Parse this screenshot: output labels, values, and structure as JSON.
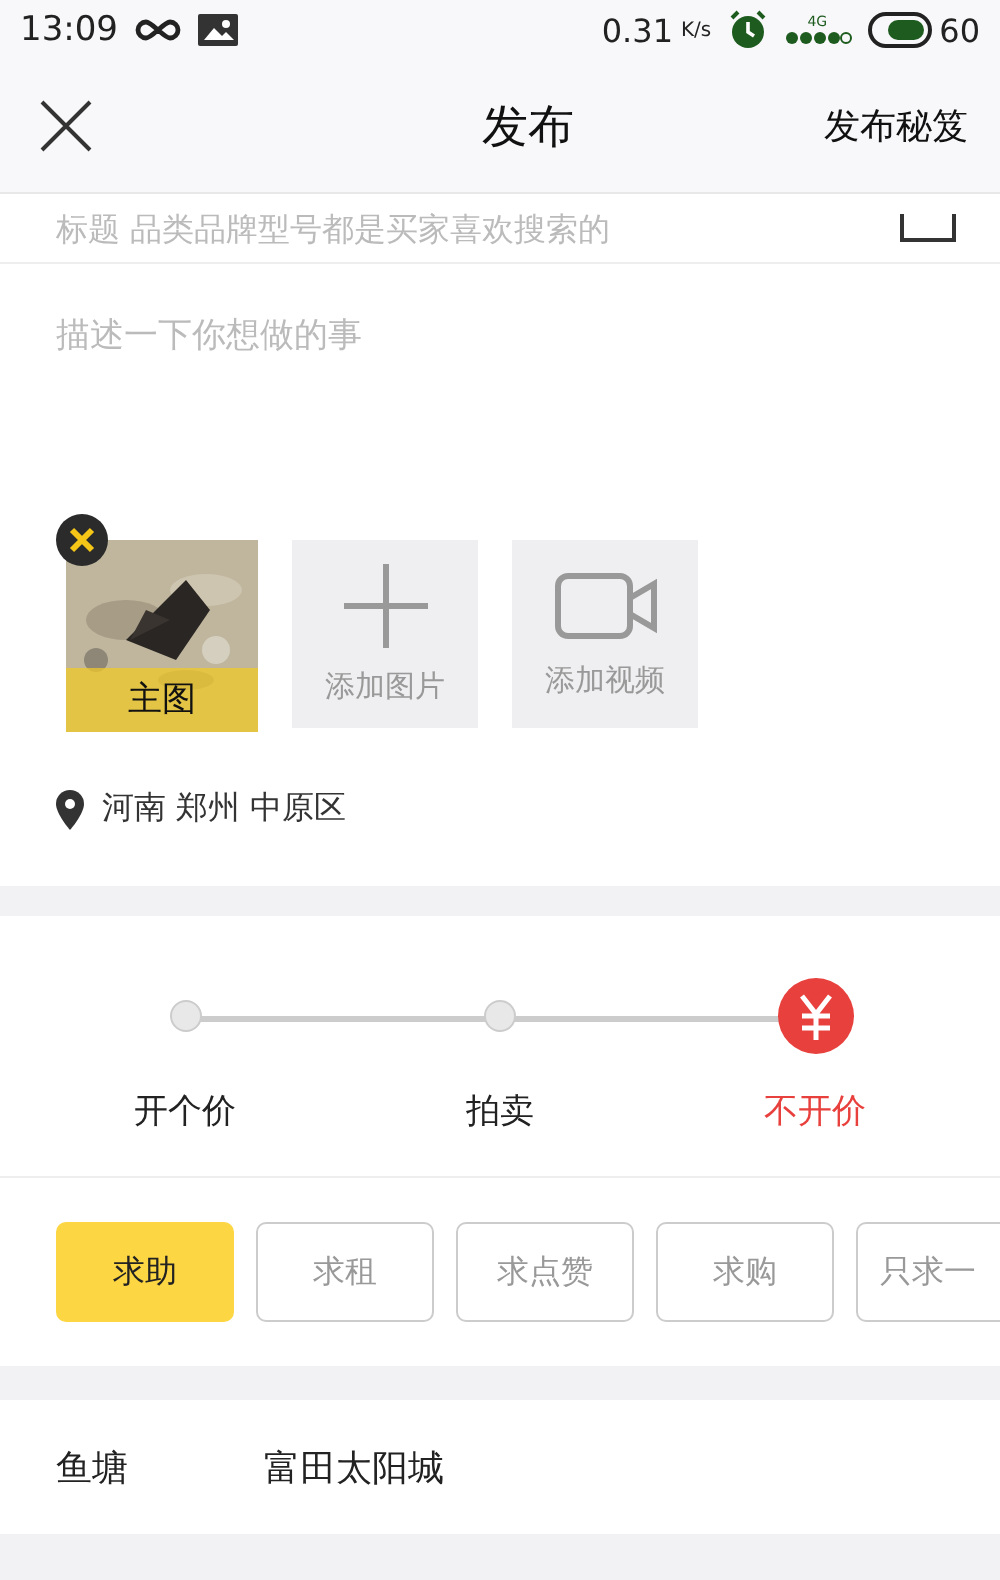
{
  "status_bar": {
    "time": "13:09",
    "speed": "0.31",
    "speed_unit": "K/s",
    "network": "4G",
    "battery": "60"
  },
  "header": {
    "title": "发布",
    "action": "发布秘笈"
  },
  "title_field": {
    "placeholder": "标题 品类品牌型号都是买家喜欢搜索的"
  },
  "description_field": {
    "placeholder": "描述一下你想做的事"
  },
  "media": [
    {
      "badge": "主图"
    },
    {
      "kind": "add_image",
      "label": "添加图片"
    },
    {
      "kind": "add_video",
      "label": "添加视频"
    }
  ],
  "location": "河南 郑州 中原区",
  "price_modes": [
    {
      "label": "开个价",
      "selected": false
    },
    {
      "label": "拍卖",
      "selected": false
    },
    {
      "label": "不开价",
      "selected": true
    }
  ],
  "categories": [
    {
      "label": "求助",
      "selected": true
    },
    {
      "label": "求租",
      "selected": false
    },
    {
      "label": "求点赞",
      "selected": false
    },
    {
      "label": "求购",
      "selected": false
    },
    {
      "label": "只求一",
      "selected": false
    }
  ],
  "pond": {
    "label": "鱼塘",
    "value": "富田太阳城"
  }
}
